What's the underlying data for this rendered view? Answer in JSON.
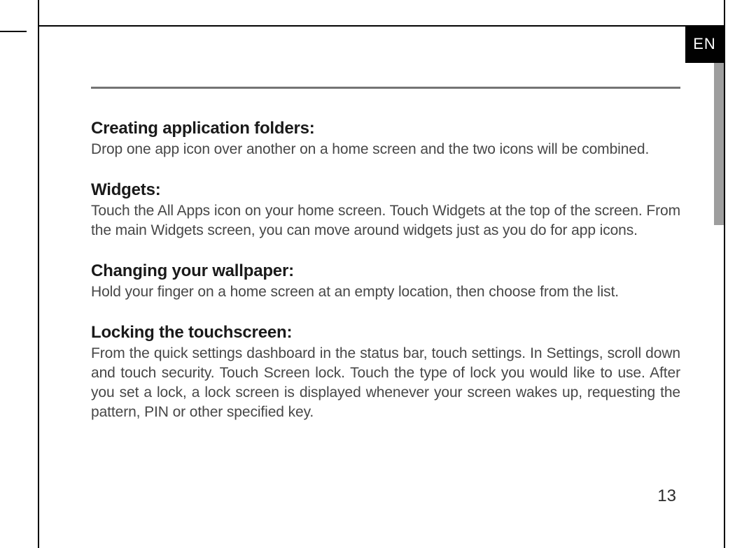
{
  "language_tab": "EN",
  "page_number": "13",
  "sections": [
    {
      "heading": "Creating application folders:",
      "body": "Drop one app icon over another on a home screen and the two icons will be combined."
    },
    {
      "heading": "Widgets:",
      "body": "Touch the All Apps icon on your home screen. Touch Widgets at the top of the screen. From the main Widgets screen, you can move around widgets just as you do for app icons."
    },
    {
      "heading": "Changing your wallpaper:",
      "body": "Hold your finger on a home screen at an empty location, then choose from the list."
    },
    {
      "heading": "Locking the touchscreen:",
      "body": "From the quick settings dashboard in the status bar, touch settings. In Settings, scroll down and touch security. Touch Screen lock. Touch the type of lock you would like to use. After you set a lock, a lock screen is displayed whenever your screen wakes up, requesting the pattern, PIN or other specified key."
    }
  ]
}
